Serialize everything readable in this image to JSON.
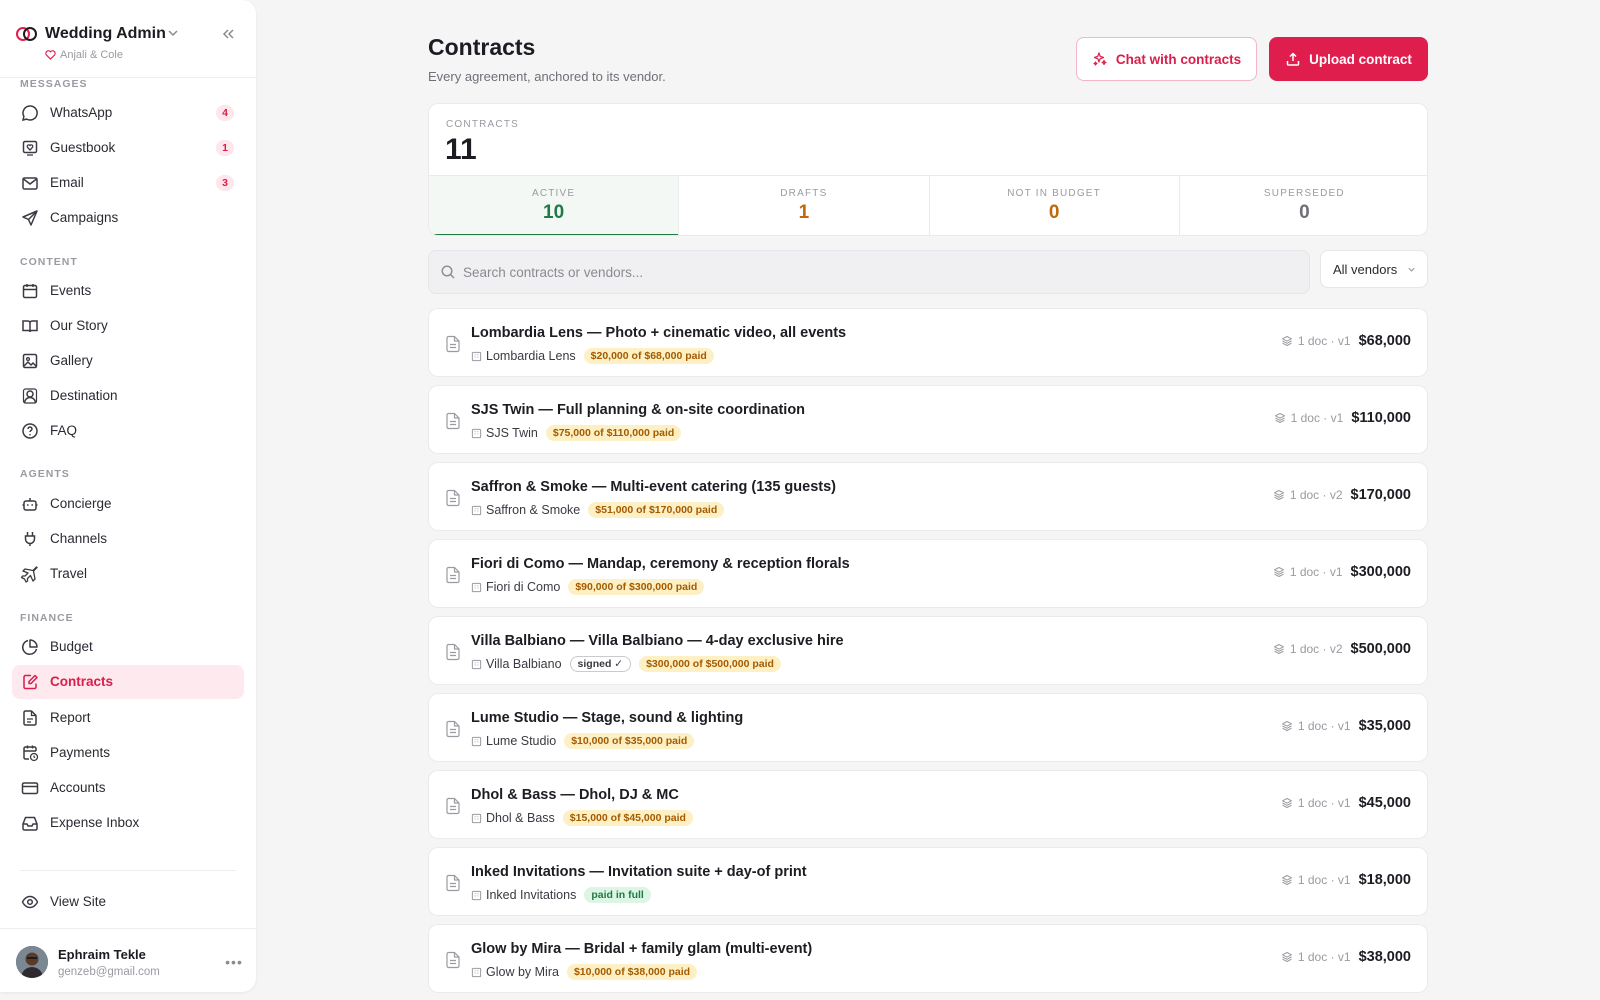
{
  "sidebar": {
    "app_title": "Wedding Admin",
    "couple": "Anjali & Cole",
    "sections": {
      "messages": "MESSAGES",
      "content": "CONTENT",
      "agents": "AGENTS",
      "finance": "FINANCE"
    },
    "items": {
      "whatsapp": {
        "label": "WhatsApp",
        "badge": "4"
      },
      "guestbook": {
        "label": "Guestbook",
        "badge": "1"
      },
      "email": {
        "label": "Email",
        "badge": "3"
      },
      "campaigns": {
        "label": "Campaigns"
      },
      "events": {
        "label": "Events"
      },
      "our_story": {
        "label": "Our Story"
      },
      "gallery": {
        "label": "Gallery"
      },
      "destination": {
        "label": "Destination"
      },
      "faq": {
        "label": "FAQ"
      },
      "concierge": {
        "label": "Concierge"
      },
      "channels": {
        "label": "Channels"
      },
      "travel": {
        "label": "Travel"
      },
      "budget": {
        "label": "Budget"
      },
      "contracts": {
        "label": "Contracts"
      },
      "report": {
        "label": "Report"
      },
      "payments": {
        "label": "Payments"
      },
      "accounts": {
        "label": "Accounts"
      },
      "expense_inbox": {
        "label": "Expense Inbox"
      },
      "view_site": {
        "label": "View Site"
      }
    },
    "user": {
      "name": "Ephraim Tekle",
      "email": "genzeb@gmail.com"
    }
  },
  "header": {
    "title": "Contracts",
    "subtitle": "Every agreement, anchored to its vendor.",
    "chat_label": "Chat with contracts",
    "upload_label": "Upload contract"
  },
  "summary": {
    "label": "CONTRACTS",
    "total": "11",
    "tabs": [
      {
        "label": "ACTIVE",
        "value": "10",
        "color": "#1f7a45"
      },
      {
        "label": "DRAFTS",
        "value": "1",
        "color": "#c0680a"
      },
      {
        "label": "NOT IN BUDGET",
        "value": "0",
        "color": "#c0680a"
      },
      {
        "label": "SUPERSEDED",
        "value": "0",
        "color": "#6f6f78"
      }
    ]
  },
  "filters": {
    "search_placeholder": "Search contracts or vendors...",
    "vendor_select": "All vendors"
  },
  "contracts": [
    {
      "title": "Lombardia Lens — Photo + cinematic video, all events",
      "vendor": "Lombardia Lens",
      "paid": "$20,000 of $68,000 paid",
      "docs": "1 doc · v1",
      "amount": "$68,000"
    },
    {
      "title": "SJS Twin — Full planning & on-site coordination",
      "vendor": "SJS Twin",
      "paid": "$75,000 of $110,000 paid",
      "docs": "1 doc · v1",
      "amount": "$110,000"
    },
    {
      "title": "Saffron & Smoke — Multi-event catering (135 guests)",
      "vendor": "Saffron & Smoke",
      "paid": "$51,000 of $170,000 paid",
      "docs": "1 doc · v2",
      "amount": "$170,000"
    },
    {
      "title": "Fiori di Como — Mandap, ceremony & reception florals",
      "vendor": "Fiori di Como",
      "paid": "$90,000 of $300,000 paid",
      "docs": "1 doc · v1",
      "amount": "$300,000"
    },
    {
      "title": "Villa Balbiano — Villa Balbiano — 4-day exclusive hire",
      "vendor": "Villa Balbiano",
      "signed": "signed ✓",
      "paid": "$300,000 of $500,000 paid",
      "docs": "1 doc · v2",
      "amount": "$500,000"
    },
    {
      "title": "Lume Studio — Stage, sound & lighting",
      "vendor": "Lume Studio",
      "paid": "$10,000 of $35,000 paid",
      "docs": "1 doc · v1",
      "amount": "$35,000"
    },
    {
      "title": "Dhol & Bass — Dhol, DJ & MC",
      "vendor": "Dhol & Bass",
      "paid": "$15,000 of $45,000 paid",
      "docs": "1 doc · v1",
      "amount": "$45,000"
    },
    {
      "title": "Inked Invitations — Invitation suite + day-of print",
      "vendor": "Inked Invitations",
      "paid_full": "paid in full",
      "docs": "1 doc · v1",
      "amount": "$18,000"
    },
    {
      "title": "Glow by Mira — Bridal + family glam (multi-event)",
      "vendor": "Glow by Mira",
      "paid": "$10,000 of $38,000 paid",
      "docs": "1 doc · v1",
      "amount": "$38,000"
    }
  ],
  "colors": {
    "accent": "#e01e4d",
    "active": "#1f7a45",
    "warn": "#c0680a"
  }
}
